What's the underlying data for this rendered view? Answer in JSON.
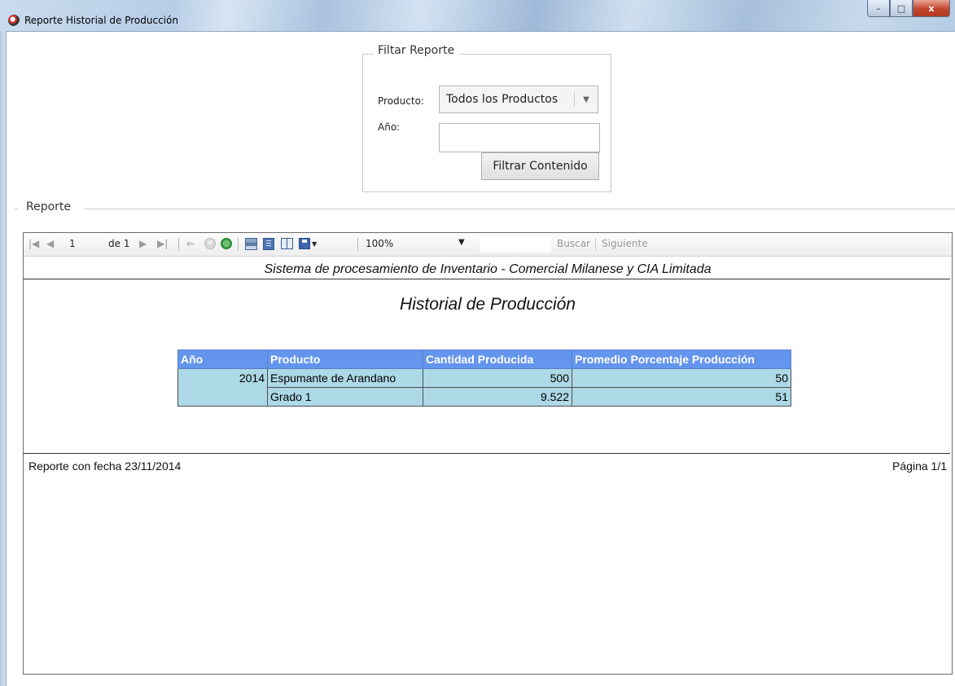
{
  "window": {
    "title": "Reporte Historial de Producción",
    "buttons": {
      "minimize": "–",
      "maximize": "□",
      "close": "x"
    }
  },
  "filter": {
    "legend": "Filtar Reporte",
    "product_label": "Producto:",
    "product_value": "Todos los Productos",
    "year_label": "Año:",
    "year_value": "",
    "submit_label": "Filtrar Contenido"
  },
  "report_group": {
    "legend": "Reporte"
  },
  "toolbar": {
    "page_current": "1",
    "page_of": "de 1",
    "zoom": "100%",
    "search_value": "",
    "find_label": "Buscar",
    "next_label": "Siguiente",
    "icons": [
      "first-page-icon",
      "prev-page-icon",
      "next-page-icon",
      "last-page-icon",
      "back-icon",
      "stop-icon",
      "refresh-icon",
      "print-icon",
      "print-layout-icon",
      "page-setup-icon",
      "export-icon"
    ]
  },
  "report": {
    "header": "Sistema de procesamiento de Inventario - Comercial Milanese y CIA Limitada",
    "title": "Historial de Producción",
    "columns": [
      "Año",
      "Producto",
      "Cantidad Producida",
      "Promedio Porcentaje Producción"
    ],
    "rows": [
      {
        "year": "2014",
        "product": "Espumante de Arandano",
        "quantity": "500",
        "average": "50"
      },
      {
        "year": "",
        "product": "Grado 1",
        "quantity": "9.522",
        "average": "51"
      }
    ],
    "footer_left": "Reporte con fecha 23/11/2014",
    "footer_right": "Página 1/1"
  },
  "colors": {
    "table_header": "#6495ed",
    "table_cell": "#add8e6"
  }
}
